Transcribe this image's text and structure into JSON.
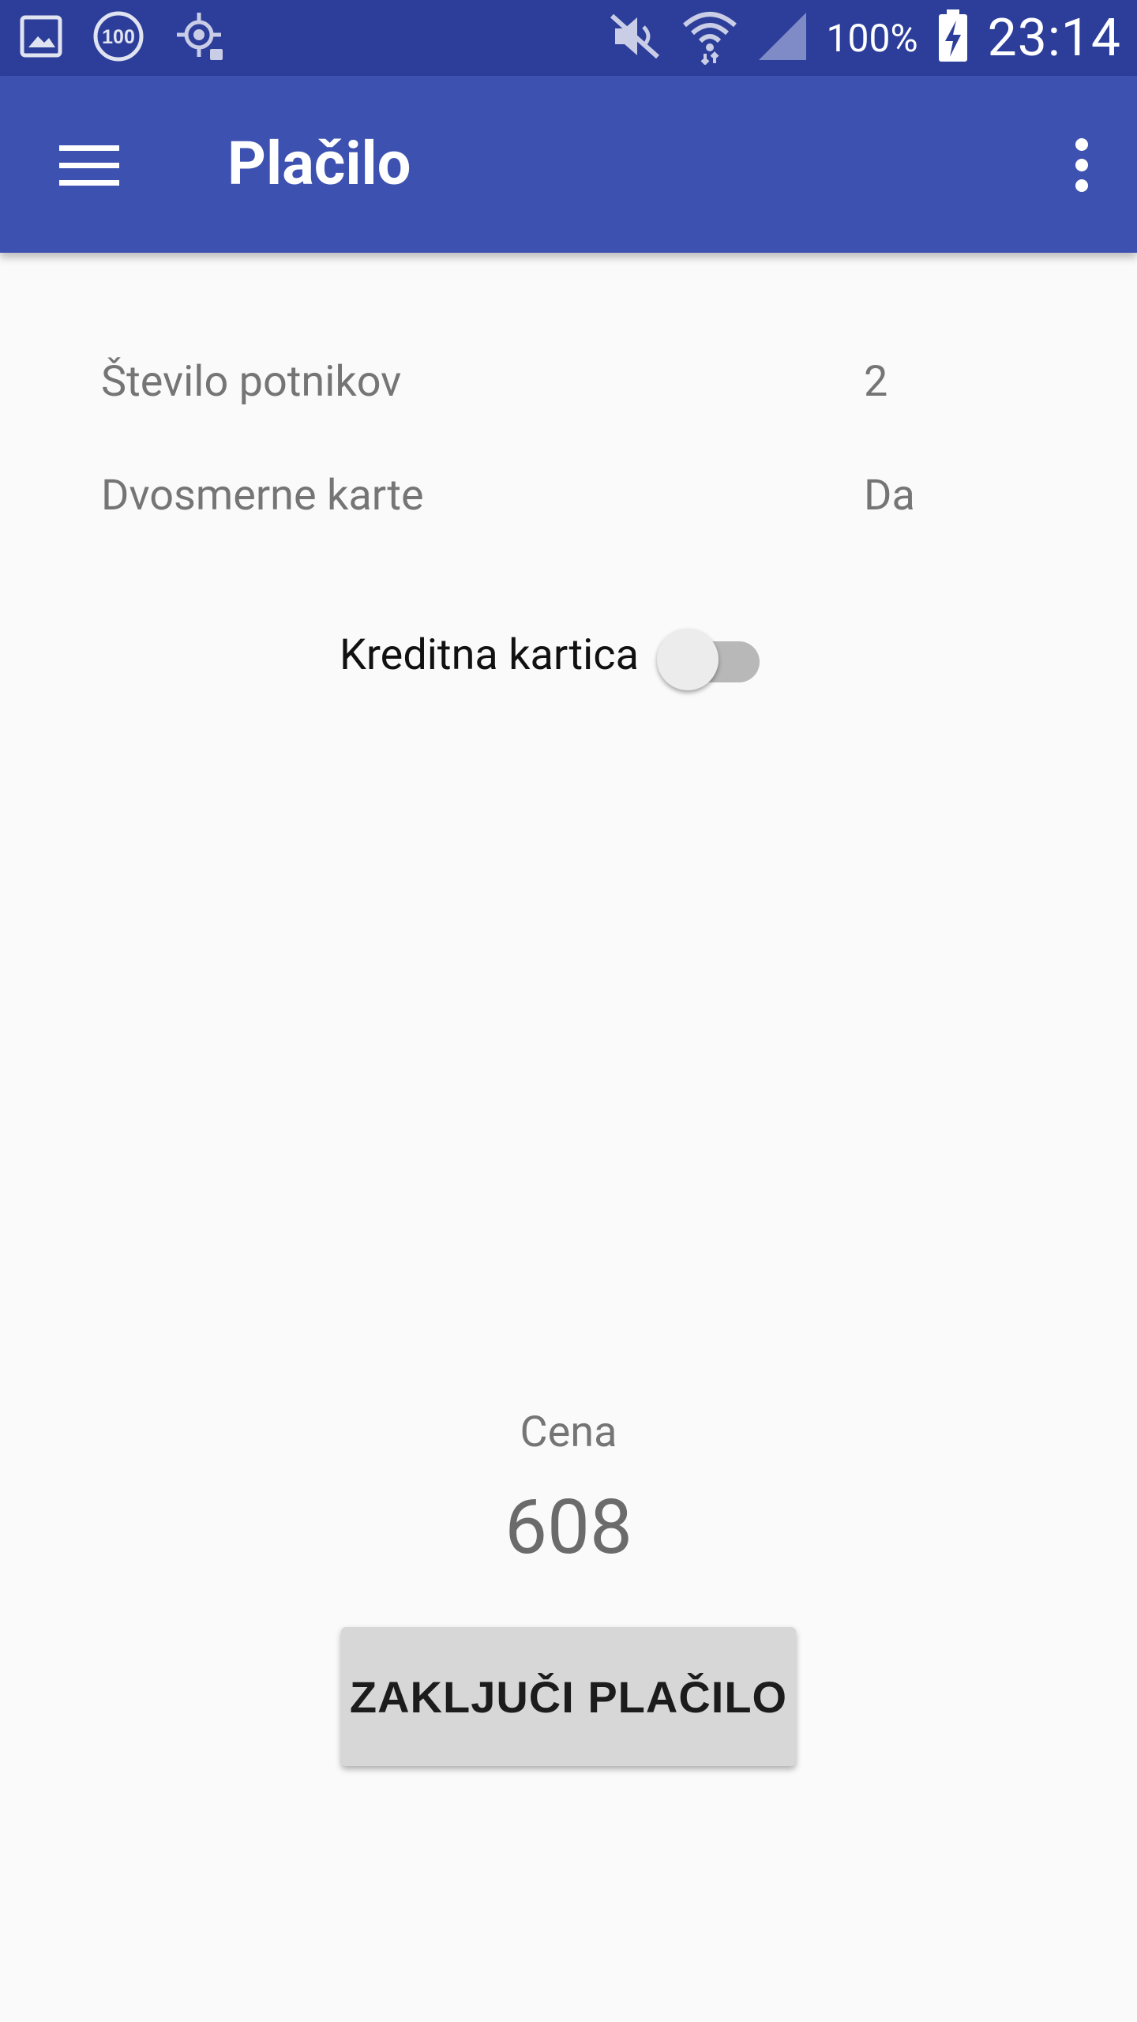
{
  "status_bar": {
    "battery_text": "100%",
    "time": "23:14",
    "icons": [
      "gallery-icon",
      "hundred-badge-icon",
      "location-icon",
      "mute-icon",
      "wifi-icon",
      "cell-signal-icon",
      "battery-charging-icon"
    ]
  },
  "app_bar": {
    "title": "Plačilo",
    "menu_icon": "hamburger-menu-icon",
    "overflow_icon": "more-vert-icon"
  },
  "details": {
    "passengers_label": "Število potnikov",
    "passengers_value": "2",
    "return_label": "Dvosmerne karte",
    "return_value": "Da"
  },
  "payment": {
    "credit_card_label": "Kreditna kartica",
    "credit_card_enabled": false
  },
  "price": {
    "label": "Cena",
    "value": "608"
  },
  "actions": {
    "finish_label": "ZAKLJUČI PLAČILO"
  },
  "colors": {
    "status_bar": "#2c3e9a",
    "app_bar": "#3d51b0",
    "background": "#fafafa",
    "button": "#d6d7d6"
  }
}
